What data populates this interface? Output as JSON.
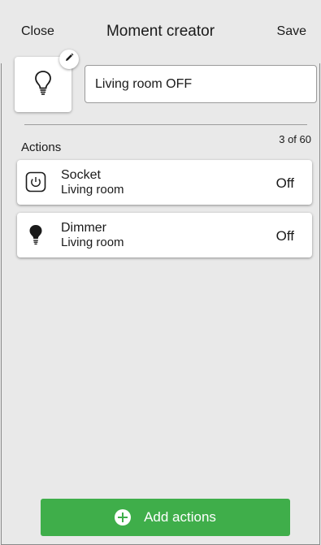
{
  "header": {
    "close_label": "Close",
    "title": "Moment creator",
    "save_label": "Save"
  },
  "moment": {
    "icon": "lightbulb-outline-icon",
    "edit_icon": "pencil-icon",
    "name_value": "Living room OFF"
  },
  "actions": {
    "label": "Actions",
    "count": "3 of 60",
    "items": [
      {
        "icon": "power-socket-icon",
        "title": "Socket",
        "room": "Living room",
        "state": "Off"
      },
      {
        "icon": "lightbulb-filled-icon",
        "title": "Dimmer",
        "room": "Living room",
        "state": "Off"
      }
    ]
  },
  "footer": {
    "add_label": "Add actions",
    "add_icon": "plus-circle-icon",
    "accent": "#3fae4a"
  }
}
